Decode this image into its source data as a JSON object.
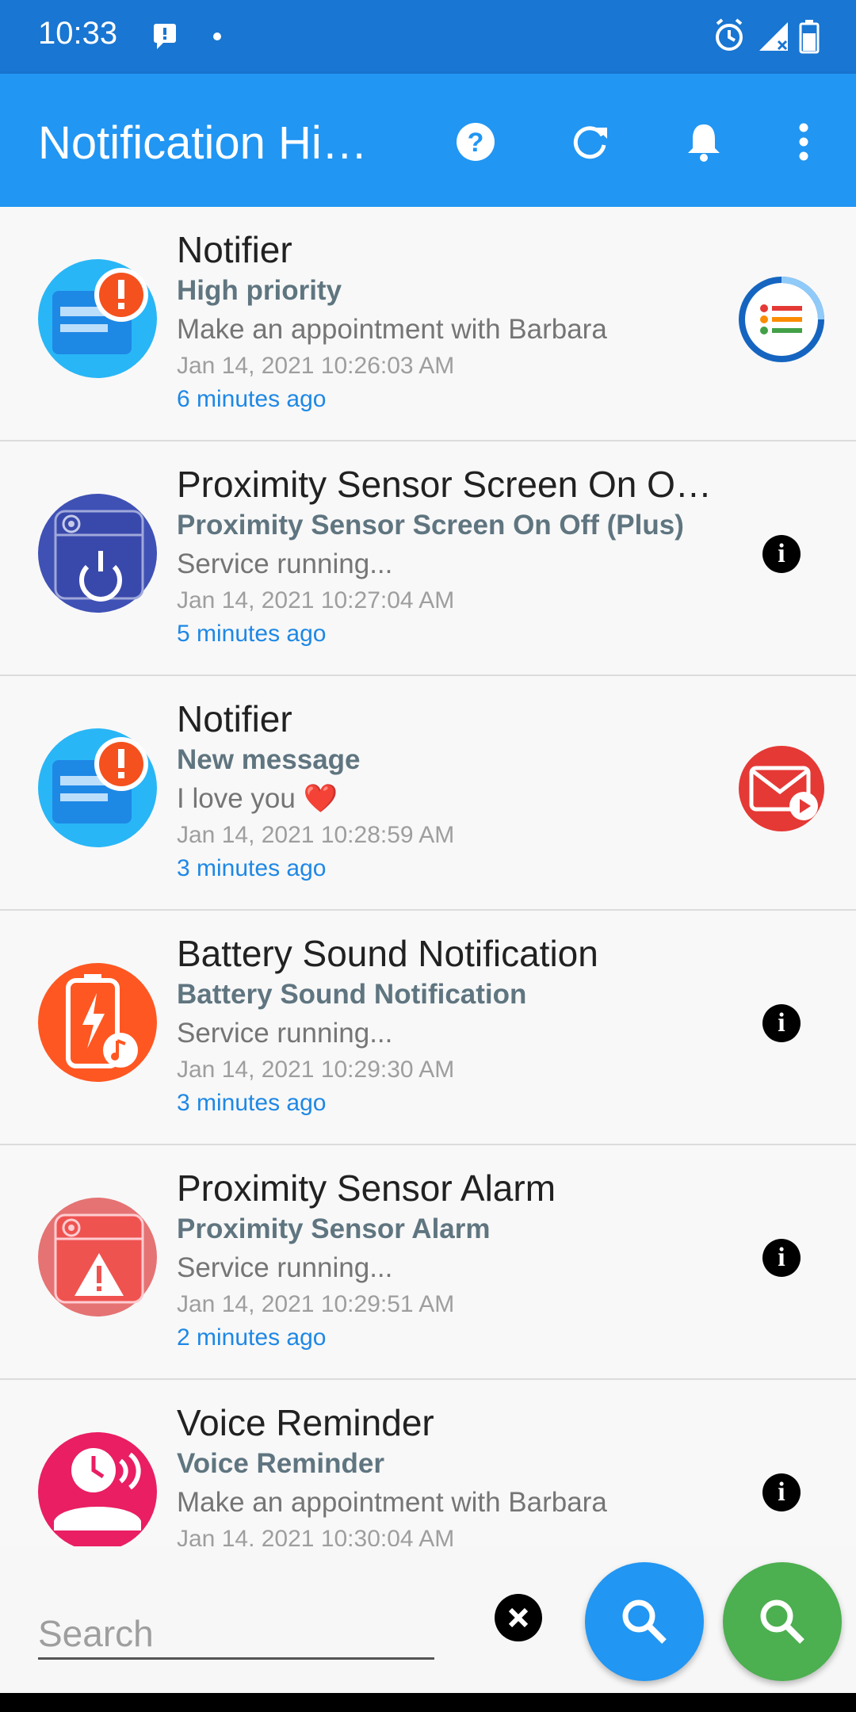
{
  "status_bar": {
    "time": "10:33",
    "left_icons": [
      "message-icon",
      "dot-icon"
    ],
    "right_icons": [
      "alarm-icon",
      "signal-icon",
      "battery-icon"
    ],
    "background": "#1976d2"
  },
  "app_bar": {
    "title": "Notification Hi…",
    "actions": [
      "help-icon",
      "refresh-icon",
      "bell-icon",
      "more-vert-icon"
    ],
    "background": "#2196f3"
  },
  "notifications": [
    {
      "app_name": "Notifier",
      "title": "High priority",
      "text": "Make an appointment with Barbara",
      "time": "Jan 14, 2021 10:26:03 AM",
      "relative": "6 minutes ago",
      "icon": "notifier-app-icon",
      "action_icon": "list-app-icon"
    },
    {
      "app_name": "Proximity Sensor Screen On O…",
      "title": "Proximity Sensor Screen On Off (Plus)",
      "text": "Service running...",
      "time": "Jan 14, 2021 10:27:04 AM",
      "relative": "5 minutes ago",
      "icon": "proximity-power-app-icon",
      "action_icon": "info-icon"
    },
    {
      "app_name": "Notifier",
      "title": "New message",
      "text": "I love you ❤️",
      "time": "Jan 14, 2021 10:28:59 AM",
      "relative": "3 minutes ago",
      "icon": "notifier-app-icon",
      "action_icon": "mail-app-icon"
    },
    {
      "app_name": "Battery Sound Notification",
      "title": "Battery Sound Notification",
      "text": "Service running...",
      "time": "Jan 14, 2021 10:29:30 AM",
      "relative": "3 minutes ago",
      "icon": "battery-sound-app-icon",
      "action_icon": "info-icon"
    },
    {
      "app_name": "Proximity Sensor Alarm",
      "title": "Proximity Sensor Alarm",
      "text": "Service running...",
      "time": "Jan 14, 2021 10:29:51 AM",
      "relative": "2 minutes ago",
      "icon": "proximity-alarm-app-icon",
      "action_icon": "info-icon"
    },
    {
      "app_name": "Voice Reminder",
      "title": "Voice Reminder",
      "text": "Make an appointment with Barbara",
      "time": "Jan 14, 2021 10:30:04 AM",
      "relative": "",
      "icon": "voice-reminder-app-icon",
      "action_icon": "info-icon"
    }
  ],
  "search": {
    "placeholder": "Search",
    "value": ""
  },
  "colors": {
    "fab_primary": "#2196f3",
    "fab_secondary": "#4caf50",
    "title_text": "#5f7580",
    "relative_time": "#1e88e5"
  }
}
